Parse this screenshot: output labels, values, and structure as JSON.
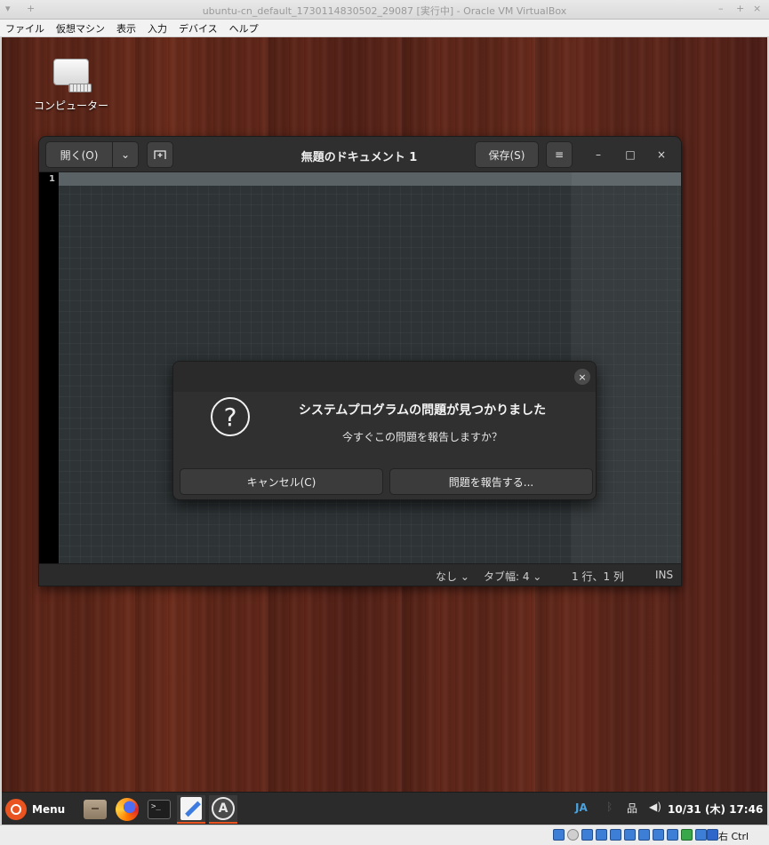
{
  "host_window": {
    "title": "ubuntu-cn_default_1730114830502_29087 [実行中] - Oracle VM VirtualBox",
    "menu": [
      "ファイル",
      "仮想マシン",
      "表示",
      "入力",
      "デバイス",
      "ヘルプ"
    ],
    "hostkey_label": "右 Ctrl"
  },
  "desktop": {
    "icon_label": "コンピューター"
  },
  "editor": {
    "open_label": "開く(O)",
    "title": "無題のドキュメント 1",
    "save_label": "保存(S)",
    "line_number": "1",
    "status": {
      "language": "なし ⌄",
      "tab_width": "タブ幅: 4 ⌄",
      "position": "1 行、1 列",
      "mode": "INS"
    }
  },
  "dialog": {
    "heading": "システムプログラムの問題が見つかりました",
    "message": "今すぐこの問題を報告しますか？",
    "cancel_label": "キャンセル(C)",
    "report_label": "問題を報告する..."
  },
  "taskbar": {
    "menu_label": "Menu",
    "input_method": "JA",
    "clock": "10/31 (木) 17:46"
  },
  "colors": {
    "accent": "#e95420",
    "editor_bg": "#2e3436",
    "dialog_bg": "#303030"
  }
}
